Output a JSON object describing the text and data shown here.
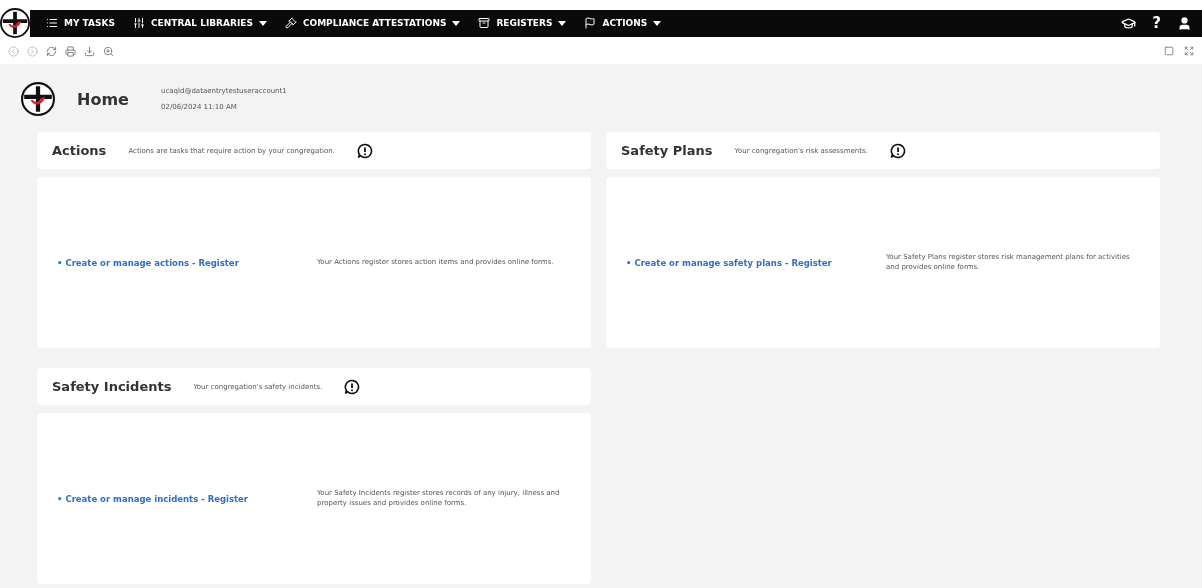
{
  "nav": {
    "items": [
      {
        "kind": "tasks",
        "label": "MY TASKS",
        "dropdown": false
      },
      {
        "kind": "libraries",
        "label": "CENTRAL LIBRARIES",
        "dropdown": true
      },
      {
        "kind": "compliance",
        "label": "COMPLIANCE ATTESTATIONS",
        "dropdown": true
      },
      {
        "kind": "registers",
        "label": "REGISTERS",
        "dropdown": true
      },
      {
        "kind": "actions",
        "label": "ACTIONS",
        "dropdown": true
      }
    ],
    "help": "?"
  },
  "header": {
    "title": "Home",
    "user": "ucaqld@dataentrytestuseraccount1",
    "datetime": "02/06/2024 11:10 AM"
  },
  "cards": [
    {
      "title": "Actions",
      "description": "Actions are tasks that require action by your congregation.",
      "link": "• Create or manage actions - Register",
      "info": "Your Actions register stores action items and provides online forms."
    },
    {
      "title": "Safety Plans",
      "description": "Your congregation's risk assessments.",
      "link": "• Create or manage safety plans - Register",
      "info": "Your Safety Plans register stores risk management plans for activities and provides online forms."
    },
    {
      "title": "Safety Incidents",
      "description": "Your congregation's safety incidents.",
      "link": "• Create or manage incidents - Register",
      "info": "Your Safety Incidents register stores records of any injury, illness and property issues and provides online forms."
    }
  ]
}
